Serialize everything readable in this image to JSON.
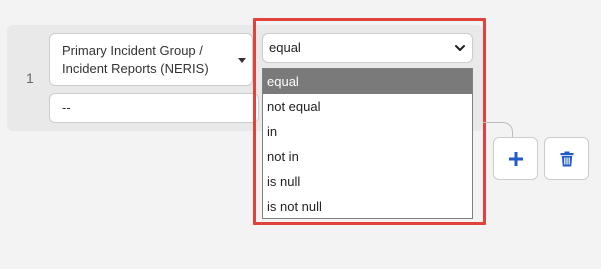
{
  "filter_row": {
    "index": "1",
    "field": {
      "label": "Primary Incident Group / Incident Reports (NERIS)"
    },
    "value_input": {
      "value": "--"
    },
    "operator": {
      "selected": "equal",
      "options": [
        "equal",
        "not equal",
        "in",
        "not in",
        "is null",
        "is not null"
      ]
    }
  },
  "actions": {
    "add_icon": "plus-icon",
    "delete_icon": "trash-icon"
  },
  "colors": {
    "highlight": "#e0433b",
    "add": "#1f5ac9",
    "delete": "#1f5ac9",
    "selected_option_bg": "#7a7a7a"
  }
}
